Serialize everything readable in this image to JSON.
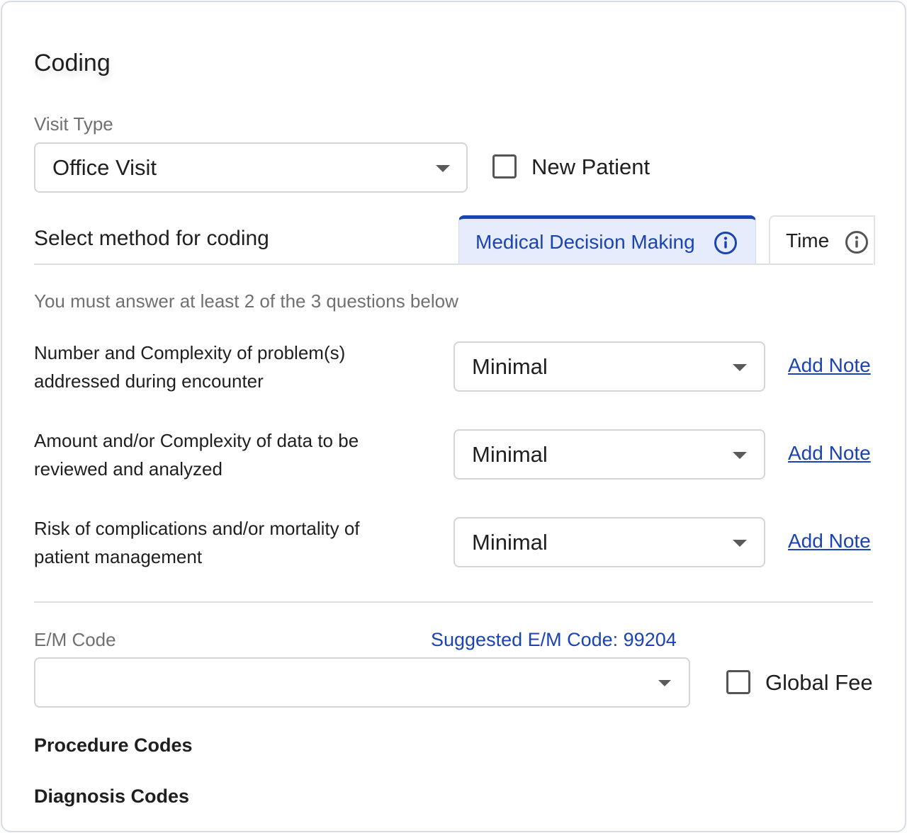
{
  "panel": {
    "title": "Coding"
  },
  "visit_type": {
    "label": "Visit Type",
    "value": "Office Visit"
  },
  "new_patient": {
    "label": "New Patient",
    "checked": false
  },
  "method": {
    "label": "Select method for  coding",
    "tabs": [
      {
        "label": "Medical Decision Making",
        "active": true,
        "icon": "info-icon"
      },
      {
        "label": "Time",
        "active": false,
        "icon": "info-icon"
      }
    ]
  },
  "instructions": "You must answer at least 2 of the 3 questions below",
  "questions": [
    {
      "line1": "Number and Complexity of problem(s)",
      "line2": "addressed during encounter",
      "value": "Minimal",
      "note_label": "Add Note"
    },
    {
      "line1": "Amount and/or Complexity of data to be",
      "line2": "reviewed and analyzed",
      "value": "Minimal",
      "note_label": "Add Note"
    },
    {
      "line1": "Risk of complications and/or mortality of",
      "line2": "patient management",
      "value": "Minimal",
      "note_label": "Add Note"
    }
  ],
  "em_code": {
    "label": "E/M Code",
    "suggested": "Suggested E/M Code: 99204",
    "value": ""
  },
  "global_fee": {
    "label": "Global Fee",
    "checked": false
  },
  "procedure_codes": {
    "label": "Procedure Codes"
  },
  "diagnosis_codes": {
    "label": "Diagnosis Codes"
  },
  "colors": {
    "accent": "#1a44b2",
    "active_tab_bg": "#e6ecfc",
    "muted_text": "#707070",
    "border": "#d5d5d5"
  }
}
